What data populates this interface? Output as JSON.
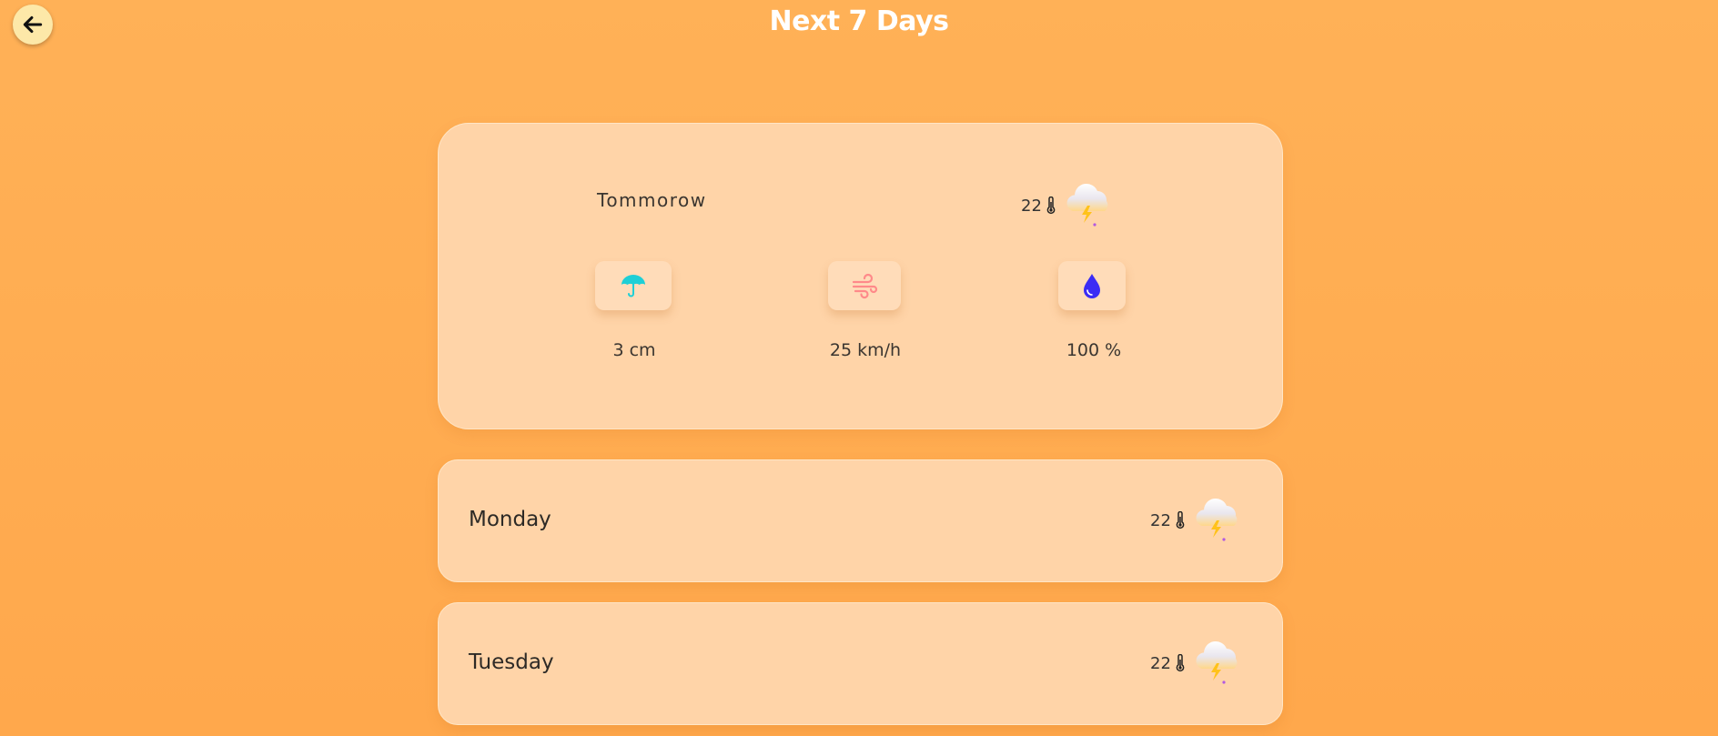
{
  "header": {
    "title": "Next 7 Days",
    "back_icon": "arrow-left-icon"
  },
  "main_card": {
    "day": "Tommorow",
    "temperature": "22",
    "temp_icon": "thermometer-icon",
    "weather_icon": "thunderstorm-cloud-icon",
    "stats": [
      {
        "icon": "umbrella-icon",
        "value": "3 cm",
        "color": "#1ecfd6"
      },
      {
        "icon": "wind-icon",
        "value": "25 km/h",
        "color": "#ff8a8a"
      },
      {
        "icon": "water-drop-icon",
        "value": "100 %",
        "color": "#3b2cf5"
      }
    ]
  },
  "days": [
    {
      "name": "Monday",
      "temperature": "22",
      "temp_icon": "thermometer-icon",
      "weather_icon": "thunderstorm-cloud-icon"
    },
    {
      "name": "Tuesday",
      "temperature": "22",
      "temp_icon": "thermometer-icon",
      "weather_icon": "thunderstorm-cloud-icon"
    }
  ],
  "colors": {
    "background": "#ffae55",
    "card": "#ffd4a8",
    "back_button": "#fde8a8"
  }
}
